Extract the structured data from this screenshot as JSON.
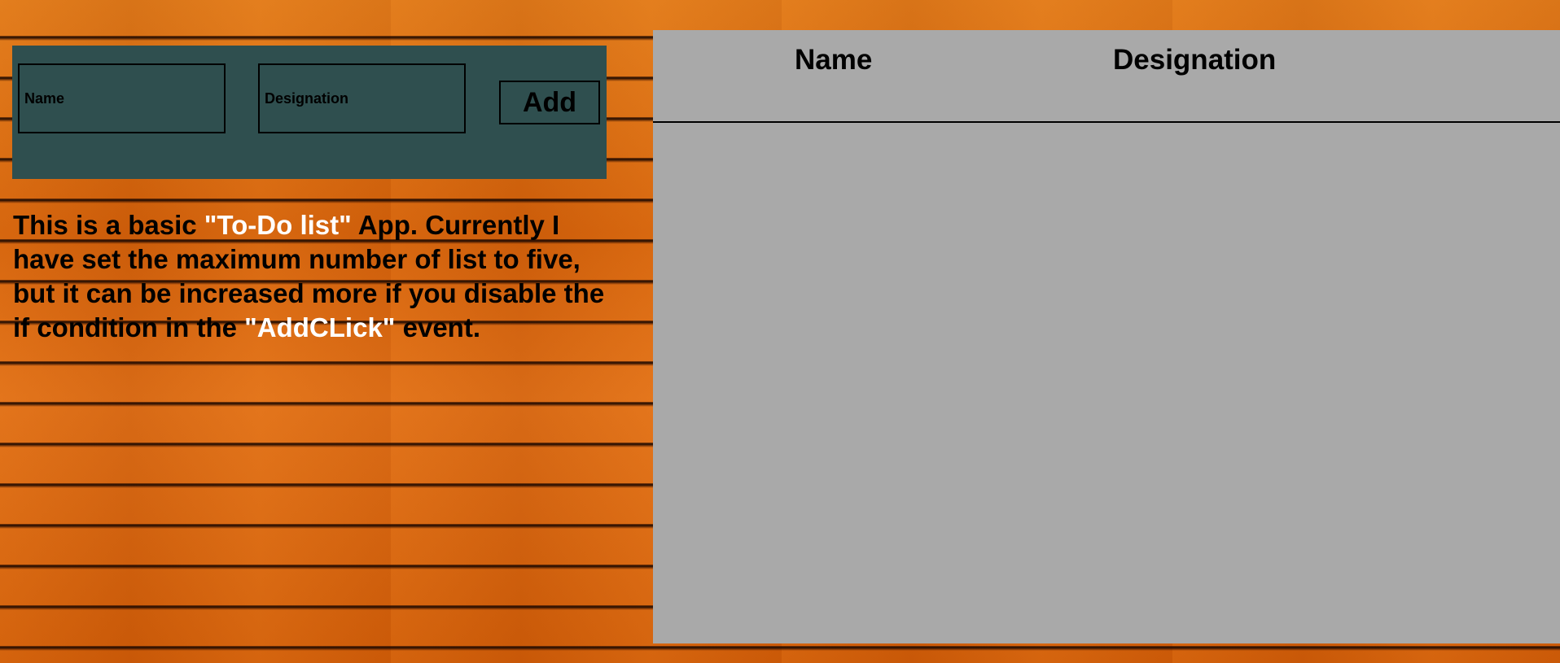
{
  "form": {
    "name_placeholder": "Name",
    "designation_placeholder": "Designation",
    "name_value": "",
    "designation_value": "",
    "add_label": "Add"
  },
  "description": {
    "part1": "This is a basic ",
    "highlight1": "\"To-Do list\"",
    "part2": " App. Currently I have set the maximum number of list to five, but it can be increased more if you disable the if condition in the ",
    "highlight2": "\"AddCLick\"",
    "part3": " event."
  },
  "list": {
    "columns": [
      "Name",
      "Designation"
    ],
    "rows": []
  },
  "colors": {
    "form_panel": "#2f4f4f",
    "list_panel": "#a9a9a9",
    "highlight_text": "#ffffff",
    "background_wood": "#d9650c"
  }
}
